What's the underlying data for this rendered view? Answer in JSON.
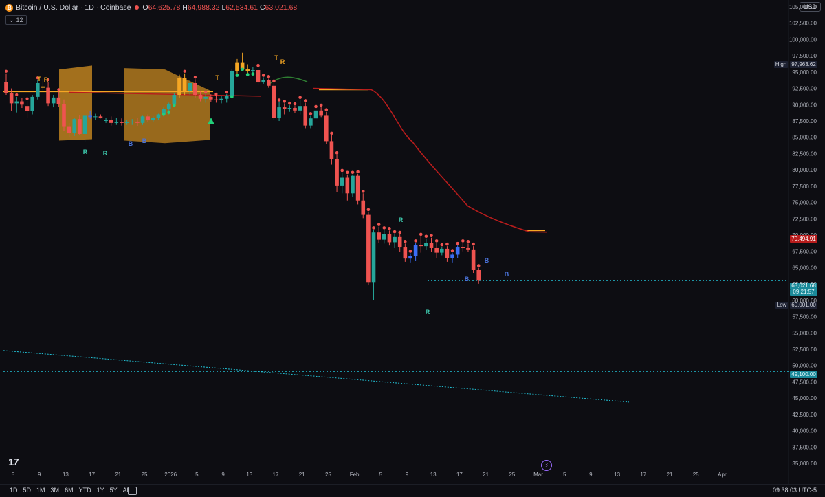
{
  "header": {
    "coin_glyph": "₿",
    "symbol": "Bitcoin / U.S. Dollar · 1D · Coinbase",
    "open_label": "O",
    "open": "64,625.78",
    "high_label": "H",
    "high": "64,988.32",
    "low_label": "L",
    "low": "62,534.61",
    "close_label": "C",
    "close": "63,021.68"
  },
  "indicator_badge": "12",
  "currency": "USD",
  "y_axis_ticks": [
    "105,000.00",
    "102,500.00",
    "100,000.00",
    "97,500.00",
    "95,000.00",
    "92,500.00",
    "90,000.00",
    "87,500.00",
    "85,000.00",
    "82,500.00",
    "80,000.00",
    "77,500.00",
    "75,000.00",
    "72,500.00",
    "70,000.00",
    "67,500.00",
    "65,000.00",
    "62,500.00",
    "60,000.00",
    "57,500.00",
    "55,000.00",
    "52,500.00",
    "50,000.00",
    "47,500.00",
    "45,000.00",
    "42,500.00",
    "40,000.00",
    "37,500.00",
    "35,000.00"
  ],
  "x_axis_ticks": [
    "5",
    "9",
    "13",
    "17",
    "21",
    "25",
    "2026",
    "5",
    "9",
    "13",
    "17",
    "21",
    "25",
    "Feb",
    "5",
    "9",
    "13",
    "17",
    "21",
    "25",
    "Mar",
    "5",
    "9",
    "13",
    "17",
    "21",
    "25",
    "Apr"
  ],
  "price_labels": {
    "high": {
      "tag": "High",
      "value": "97,963.62"
    },
    "ma": {
      "value": "70,494.91"
    },
    "last": {
      "value": "63,021.68",
      "countdown": "09:21:57"
    },
    "low": {
      "tag": "Low",
      "value": "60,001.00"
    },
    "support": {
      "value": "49,100.00"
    }
  },
  "markers": [
    "T",
    "R",
    "B"
  ],
  "timeframes": [
    "1D",
    "5D",
    "1M",
    "3M",
    "6M",
    "YTD",
    "1Y",
    "5Y",
    "All"
  ],
  "clock": "09:38:03 UTC-5",
  "logo_text": "17",
  "colors": {
    "up": "#26a69a",
    "down": "#ef5350",
    "orange": "#f5a623",
    "ma": "#b71c1c",
    "cyan": "#22c2d6",
    "blue": "#2962ff",
    "bg": "#0d0d12"
  },
  "chart_data": {
    "type": "candlestick",
    "title": "Bitcoin / U.S. Dollar · 1D · Coinbase",
    "ylim": [
      34000,
      106500
    ],
    "xlabel": "",
    "ylabel": "",
    "candles": [
      {
        "o": 93500,
        "h": 94800,
        "l": 91500,
        "c": 91800
      },
      {
        "o": 91800,
        "h": 92500,
        "l": 89000,
        "c": 90200
      },
      {
        "o": 90200,
        "h": 91200,
        "l": 88800,
        "c": 90500
      },
      {
        "o": 90500,
        "h": 91000,
        "l": 89500,
        "c": 90000
      },
      {
        "o": 89800,
        "h": 90600,
        "l": 88000,
        "c": 89000
      },
      {
        "o": 89000,
        "h": 91500,
        "l": 88500,
        "c": 91200
      },
      {
        "o": 91200,
        "h": 93800,
        "l": 90800,
        "c": 93300
      },
      {
        "o": 92800,
        "h": 93900,
        "l": 92200,
        "c": 92600
      },
      {
        "o": 92600,
        "h": 93500,
        "l": 89800,
        "c": 90200
      },
      {
        "o": 90200,
        "h": 91500,
        "l": 89600,
        "c": 91100
      },
      {
        "o": 91100,
        "h": 92000,
        "l": 89700,
        "c": 90100
      },
      {
        "o": 90100,
        "h": 90800,
        "l": 86000,
        "c": 86600
      },
      {
        "o": 86600,
        "h": 87200,
        "l": 85000,
        "c": 85700
      },
      {
        "o": 85700,
        "h": 88000,
        "l": 85200,
        "c": 87800
      },
      {
        "o": 87800,
        "h": 88400,
        "l": 85300,
        "c": 85500
      },
      {
        "o": 85500,
        "h": 88500,
        "l": 84300,
        "c": 88300
      },
      {
        "o": 88300,
        "h": 89000,
        "l": 87800,
        "c": 88100
      },
      {
        "o": 88100,
        "h": 88600,
        "l": 87700,
        "c": 88200
      },
      {
        "o": 88200,
        "h": 88500,
        "l": 87900,
        "c": 88000
      },
      {
        "o": 87500,
        "h": 88000,
        "l": 87200,
        "c": 87700
      },
      {
        "o": 87700,
        "h": 88200,
        "l": 86800,
        "c": 87200
      },
      {
        "o": 87200,
        "h": 88000,
        "l": 86900,
        "c": 87300
      },
      {
        "o": 87300,
        "h": 87900,
        "l": 86800,
        "c": 87200
      },
      {
        "o": 87200,
        "h": 87700,
        "l": 86900,
        "c": 87300
      },
      {
        "o": 87300,
        "h": 87800,
        "l": 86900,
        "c": 87400
      },
      {
        "o": 87400,
        "h": 88000,
        "l": 86700,
        "c": 87200
      },
      {
        "o": 87200,
        "h": 88300,
        "l": 86900,
        "c": 88200
      },
      {
        "o": 88200,
        "h": 88500,
        "l": 87300,
        "c": 87600
      },
      {
        "o": 87600,
        "h": 88200,
        "l": 87300,
        "c": 88000
      },
      {
        "o": 88000,
        "h": 88600,
        "l": 87700,
        "c": 88500
      },
      {
        "o": 88500,
        "h": 89600,
        "l": 88200,
        "c": 89400
      },
      {
        "o": 89400,
        "h": 90300,
        "l": 88500,
        "c": 90100
      },
      {
        "o": 90100,
        "h": 91800,
        "l": 89600,
        "c": 91500
      },
      {
        "o": 91500,
        "h": 94600,
        "l": 91100,
        "c": 94100
      },
      {
        "o": 94100,
        "h": 94800,
        "l": 91500,
        "c": 92100
      },
      {
        "o": 92100,
        "h": 93800,
        "l": 91500,
        "c": 93300
      },
      {
        "o": 93300,
        "h": 93900,
        "l": 91100,
        "c": 91500
      },
      {
        "o": 91500,
        "h": 92000,
        "l": 90500,
        "c": 90900
      },
      {
        "o": 90900,
        "h": 91600,
        "l": 90300,
        "c": 91200
      },
      {
        "o": 91200,
        "h": 91600,
        "l": 90400,
        "c": 90800
      },
      {
        "o": 90800,
        "h": 91300,
        "l": 90300,
        "c": 90700
      },
      {
        "o": 90700,
        "h": 91300,
        "l": 90200,
        "c": 90900
      },
      {
        "o": 90900,
        "h": 91600,
        "l": 90300,
        "c": 91400
      },
      {
        "o": 91400,
        "h": 95400,
        "l": 91000,
        "c": 95200
      },
      {
        "o": 95200,
        "h": 97000,
        "l": 94300,
        "c": 96500
      },
      {
        "o": 96500,
        "h": 97963,
        "l": 95200,
        "c": 95400
      },
      {
        "o": 95400,
        "h": 96200,
        "l": 94400,
        "c": 95100
      },
      {
        "o": 95100,
        "h": 95800,
        "l": 94500,
        "c": 95300
      },
      {
        "o": 95300,
        "h": 95700,
        "l": 93000,
        "c": 93400
      },
      {
        "o": 93400,
        "h": 94200,
        "l": 93200,
        "c": 93800
      },
      {
        "o": 93800,
        "h": 94000,
        "l": 92600,
        "c": 92900
      },
      {
        "o": 92900,
        "h": 93300,
        "l": 87600,
        "c": 88000
      },
      {
        "o": 88000,
        "h": 90400,
        "l": 87500,
        "c": 89600
      },
      {
        "o": 89600,
        "h": 90200,
        "l": 88500,
        "c": 89300
      },
      {
        "o": 89300,
        "h": 89900,
        "l": 88900,
        "c": 89500
      },
      {
        "o": 89500,
        "h": 89800,
        "l": 88700,
        "c": 89100
      },
      {
        "o": 89100,
        "h": 90800,
        "l": 88500,
        "c": 89800
      },
      {
        "o": 89800,
        "h": 90300,
        "l": 86400,
        "c": 86800
      },
      {
        "o": 86800,
        "h": 88300,
        "l": 86400,
        "c": 87900
      },
      {
        "o": 87900,
        "h": 89400,
        "l": 87600,
        "c": 89100
      },
      {
        "o": 89100,
        "h": 89600,
        "l": 88100,
        "c": 88300
      },
      {
        "o": 88300,
        "h": 88900,
        "l": 84000,
        "c": 84400
      },
      {
        "o": 84400,
        "h": 85300,
        "l": 80800,
        "c": 81600
      },
      {
        "o": 81600,
        "h": 82300,
        "l": 76600,
        "c": 77600
      },
      {
        "o": 77600,
        "h": 79600,
        "l": 76400,
        "c": 78800
      },
      {
        "o": 78800,
        "h": 79300,
        "l": 75300,
        "c": 76400
      },
      {
        "o": 76400,
        "h": 79300,
        "l": 75800,
        "c": 79100
      },
      {
        "o": 79100,
        "h": 79400,
        "l": 74700,
        "c": 75300
      },
      {
        "o": 75300,
        "h": 76400,
        "l": 72600,
        "c": 73100
      },
      {
        "o": 73100,
        "h": 73600,
        "l": 62300,
        "c": 62800
      },
      {
        "o": 62800,
        "h": 70800,
        "l": 60001,
        "c": 70400
      },
      {
        "o": 70400,
        "h": 71300,
        "l": 68800,
        "c": 69300
      },
      {
        "o": 69300,
        "h": 70800,
        "l": 68700,
        "c": 70200
      },
      {
        "o": 70200,
        "h": 70700,
        "l": 68400,
        "c": 68900
      },
      {
        "o": 68900,
        "h": 70200,
        "l": 68000,
        "c": 69700
      },
      {
        "o": 69700,
        "h": 70100,
        "l": 67400,
        "c": 68100
      },
      {
        "o": 68100,
        "h": 68700,
        "l": 65900,
        "c": 66400
      },
      {
        "o": 66400,
        "h": 67200,
        "l": 65800,
        "c": 66800
      },
      {
        "o": 66800,
        "h": 68800,
        "l": 66000,
        "c": 68500
      },
      {
        "o": 68500,
        "h": 69800,
        "l": 67300,
        "c": 68300
      },
      {
        "o": 68300,
        "h": 69500,
        "l": 67700,
        "c": 68800
      },
      {
        "o": 68800,
        "h": 69600,
        "l": 67400,
        "c": 68000
      },
      {
        "o": 68000,
        "h": 68800,
        "l": 66500,
        "c": 67300
      },
      {
        "o": 67300,
        "h": 68200,
        "l": 66900,
        "c": 67900
      },
      {
        "o": 67900,
        "h": 68300,
        "l": 65900,
        "c": 66500
      },
      {
        "o": 66500,
        "h": 67300,
        "l": 65800,
        "c": 67000
      },
      {
        "o": 67000,
        "h": 68400,
        "l": 66500,
        "c": 68100
      },
      {
        "o": 68100,
        "h": 68800,
        "l": 67500,
        "c": 68000
      },
      {
        "o": 68000,
        "h": 68700,
        "l": 67400,
        "c": 67800
      },
      {
        "o": 67800,
        "h": 68300,
        "l": 64200,
        "c": 64625
      },
      {
        "o": 64625,
        "h": 64988,
        "l": 62534,
        "c": 63021
      }
    ]
  }
}
